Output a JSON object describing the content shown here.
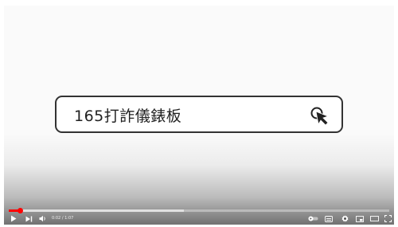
{
  "video": {
    "search_text": "165打詐儀錶板"
  },
  "player": {
    "time_current": "0:02",
    "time_separator": "/",
    "time_total": "1:07",
    "progress_fraction": 0.03,
    "loaded_fraction": 0.46,
    "accent_color": "#ff0000"
  },
  "icons": {
    "play": "play-icon",
    "next": "next-icon",
    "volume": "volume-icon",
    "autoplay": "autoplay-toggle-icon",
    "subtitles": "subtitles-icon",
    "settings": "gear-icon",
    "miniplayer": "miniplayer-icon",
    "theater": "theater-mode-icon",
    "fullscreen": "fullscreen-icon",
    "cursor": "mouse-cursor-icon"
  }
}
